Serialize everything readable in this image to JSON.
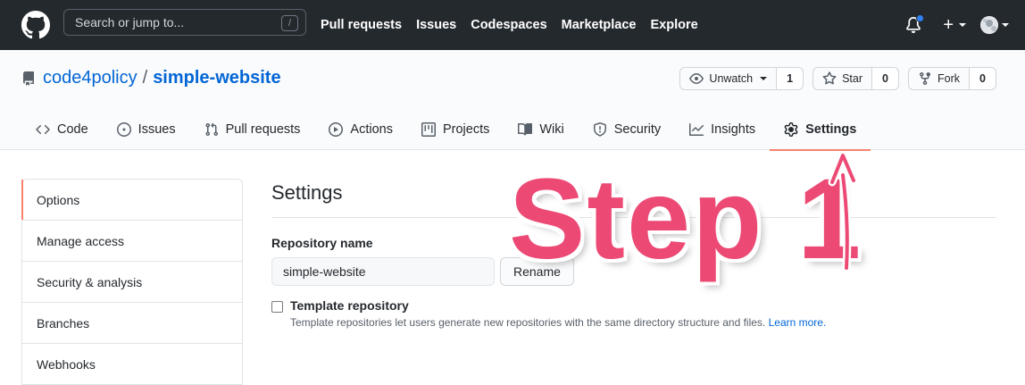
{
  "header": {
    "search_placeholder": "Search or jump to...",
    "slash_key": "/",
    "nav": [
      "Pull requests",
      "Issues",
      "Codespaces",
      "Marketplace",
      "Explore"
    ],
    "plus_icon": "plus-icon"
  },
  "repo": {
    "owner": "code4policy",
    "separator": "/",
    "name": "simple-website",
    "watch_label": "Unwatch",
    "watch_count": "1",
    "star_label": "Star",
    "star_count": "0",
    "fork_label": "Fork",
    "fork_count": "0"
  },
  "tabs": [
    {
      "label": "Code",
      "icon": "code-icon"
    },
    {
      "label": "Issues",
      "icon": "issue-icon"
    },
    {
      "label": "Pull requests",
      "icon": "pull-request-icon"
    },
    {
      "label": "Actions",
      "icon": "play-icon"
    },
    {
      "label": "Projects",
      "icon": "project-icon"
    },
    {
      "label": "Wiki",
      "icon": "book-icon"
    },
    {
      "label": "Security",
      "icon": "shield-icon"
    },
    {
      "label": "Insights",
      "icon": "graph-icon"
    },
    {
      "label": "Settings",
      "icon": "gear-icon",
      "selected": true
    }
  ],
  "sidebar": {
    "items": [
      {
        "label": "Options",
        "selected": true
      },
      {
        "label": "Manage access"
      },
      {
        "label": "Security & analysis"
      },
      {
        "label": "Branches"
      },
      {
        "label": "Webhooks"
      }
    ]
  },
  "main": {
    "title": "Settings",
    "repo_name_label": "Repository name",
    "repo_name_value": "simple-website",
    "rename_label": "Rename",
    "template_label": "Template repository",
    "template_desc": "Template repositories let users generate new repositories with the same directory structure and files.",
    "learn_more": "Learn more.",
    "template_checked": false
  },
  "annotation": {
    "text": "Step 1",
    "color": "#ec4a75"
  },
  "colors": {
    "header_bg": "#24292e",
    "link": "#0366d6",
    "selected_underline": "#f9826c"
  }
}
